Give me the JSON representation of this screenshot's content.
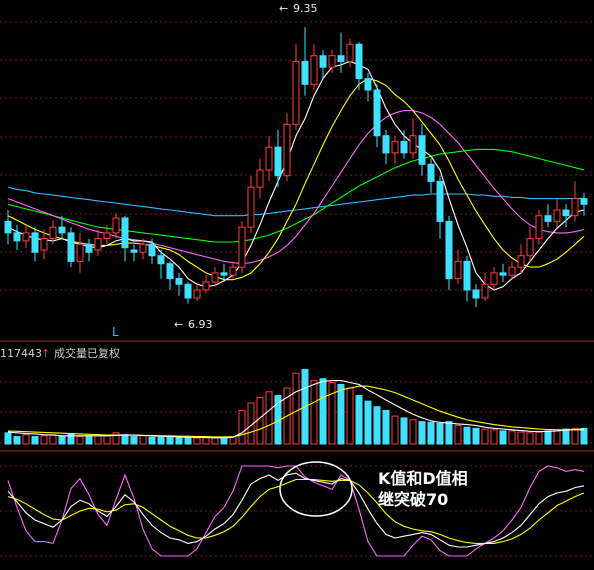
{
  "chart_data": {
    "type": "candlestick",
    "colors": {
      "up": "#ff3b3b",
      "down": "#40e0ff",
      "ma5": "#ffffff",
      "ma10": "#ffff00",
      "ma20": "#ff66ff",
      "ma30": "#00ff00",
      "ma60": "#33bbff",
      "k": "#ffffff",
      "d": "#ffff00",
      "j": "#ff66ff",
      "grid": "#7a1a1a"
    },
    "price": {
      "ylim": [
        6.7,
        9.5
      ],
      "high_label": "9.35",
      "low_label": "6.93",
      "candles": [
        [
          7.65,
          7.55,
          7.75,
          7.45
        ],
        [
          7.55,
          7.48,
          7.62,
          7.4
        ],
        [
          7.48,
          7.55,
          7.62,
          7.42
        ],
        [
          7.55,
          7.38,
          7.6,
          7.3
        ],
        [
          7.4,
          7.5,
          7.58,
          7.32
        ],
        [
          7.5,
          7.6,
          7.66,
          7.45
        ],
        [
          7.6,
          7.55,
          7.7,
          7.5
        ],
        [
          7.55,
          7.3,
          7.6,
          7.25
        ],
        [
          7.3,
          7.45,
          7.55,
          7.2
        ],
        [
          7.45,
          7.38,
          7.5,
          7.3
        ],
        [
          7.4,
          7.5,
          7.58,
          7.35
        ],
        [
          7.5,
          7.55,
          7.62,
          7.45
        ],
        [
          7.55,
          7.68,
          7.72,
          7.5
        ],
        [
          7.68,
          7.42,
          7.7,
          7.3
        ],
        [
          7.4,
          7.38,
          7.45,
          7.3
        ],
        [
          7.38,
          7.45,
          7.5,
          7.32
        ],
        [
          7.45,
          7.35,
          7.5,
          7.28
        ],
        [
          7.35,
          7.28,
          7.4,
          7.15
        ],
        [
          7.28,
          7.15,
          7.3,
          7.05
        ],
        [
          7.15,
          7.1,
          7.2,
          7.0
        ],
        [
          7.1,
          6.98,
          7.12,
          6.93
        ],
        [
          6.98,
          7.05,
          7.1,
          6.95
        ],
        [
          7.05,
          7.12,
          7.18,
          7.02
        ],
        [
          7.12,
          7.2,
          7.25,
          7.08
        ],
        [
          7.2,
          7.18,
          7.28,
          7.12
        ],
        [
          7.18,
          7.25,
          7.3,
          7.15
        ],
        [
          7.25,
          7.6,
          7.65,
          7.2
        ],
        [
          7.6,
          7.95,
          8.05,
          7.55
        ],
        [
          7.95,
          8.1,
          8.2,
          7.85
        ],
        [
          8.1,
          8.3,
          8.4,
          8.0
        ],
        [
          8.3,
          8.05,
          8.45,
          7.95
        ],
        [
          8.05,
          8.5,
          8.6,
          8.0
        ],
        [
          8.5,
          9.05,
          9.2,
          8.45
        ],
        [
          9.05,
          8.85,
          9.35,
          8.75
        ],
        [
          8.85,
          9.1,
          9.2,
          8.8
        ],
        [
          9.1,
          9.0,
          9.15,
          8.9
        ],
        [
          9.0,
          9.1,
          9.15,
          8.95
        ],
        [
          9.1,
          9.05,
          9.3,
          8.95
        ],
        [
          9.05,
          9.2,
          9.25,
          9.0
        ],
        [
          9.2,
          8.9,
          9.22,
          8.8
        ],
        [
          8.9,
          8.8,
          8.95,
          8.7
        ],
        [
          8.8,
          8.4,
          8.85,
          8.3
        ],
        [
          8.4,
          8.25,
          8.45,
          8.15
        ],
        [
          8.25,
          8.35,
          8.4,
          8.15
        ],
        [
          8.35,
          8.25,
          8.45,
          8.2
        ],
        [
          8.25,
          8.4,
          8.55,
          8.2
        ],
        [
          8.4,
          8.15,
          8.5,
          8.05
        ],
        [
          8.15,
          8.0,
          8.2,
          7.9
        ],
        [
          8.0,
          7.65,
          8.05,
          7.5
        ],
        [
          7.65,
          7.15,
          7.7,
          7.05
        ],
        [
          7.15,
          7.3,
          7.4,
          7.1
        ],
        [
          7.3,
          7.05,
          7.35,
          6.95
        ],
        [
          7.05,
          6.98,
          7.1,
          6.9
        ],
        [
          6.98,
          7.1,
          7.2,
          6.95
        ],
        [
          7.1,
          7.2,
          7.25,
          7.05
        ],
        [
          7.2,
          7.18,
          7.28,
          7.12
        ],
        [
          7.18,
          7.25,
          7.3,
          7.15
        ],
        [
          7.25,
          7.35,
          7.45,
          7.2
        ],
        [
          7.35,
          7.5,
          7.6,
          7.3
        ],
        [
          7.5,
          7.7,
          7.75,
          7.45
        ],
        [
          7.7,
          7.65,
          7.8,
          7.6
        ],
        [
          7.65,
          7.75,
          7.85,
          7.6
        ],
        [
          7.75,
          7.7,
          7.8,
          7.6
        ],
        [
          7.7,
          7.85,
          8.0,
          7.65
        ],
        [
          7.85,
          7.8,
          7.9,
          7.7
        ]
      ],
      "ma5": [
        7.6,
        7.56,
        7.53,
        7.5,
        7.49,
        7.48,
        7.5,
        7.47,
        7.45,
        7.43,
        7.42,
        7.44,
        7.48,
        7.5,
        7.48,
        7.48,
        7.47,
        7.38,
        7.32,
        7.25,
        7.15,
        7.1,
        7.08,
        7.09,
        7.13,
        7.18,
        7.29,
        7.44,
        7.62,
        7.82,
        8.0,
        8.18,
        8.4,
        8.55,
        8.75,
        8.9,
        9.0,
        9.02,
        9.05,
        9.02,
        8.98,
        8.82,
        8.64,
        8.5,
        8.4,
        8.33,
        8.28,
        8.22,
        8.1,
        7.85,
        7.62,
        7.42,
        7.2,
        7.1,
        7.05,
        7.08,
        7.15,
        7.2,
        7.3,
        7.4,
        7.5,
        7.59,
        7.66,
        7.73,
        7.75
      ],
      "ma10": [
        7.7,
        7.66,
        7.62,
        7.58,
        7.55,
        7.52,
        7.5,
        7.48,
        7.46,
        7.45,
        7.44,
        7.44,
        7.45,
        7.46,
        7.46,
        7.45,
        7.44,
        7.42,
        7.4,
        7.36,
        7.3,
        7.25,
        7.2,
        7.17,
        7.14,
        7.14,
        7.16,
        7.2,
        7.28,
        7.38,
        7.5,
        7.65,
        7.8,
        7.98,
        8.15,
        8.32,
        8.48,
        8.62,
        8.75,
        8.85,
        8.9,
        8.88,
        8.84,
        8.76,
        8.7,
        8.62,
        8.52,
        8.42,
        8.32,
        8.18,
        8.02,
        7.88,
        7.74,
        7.62,
        7.5,
        7.4,
        7.33,
        7.28,
        7.25,
        7.25,
        7.28,
        7.32,
        7.38,
        7.45,
        7.52
      ],
      "ma20": [
        7.85,
        7.82,
        7.79,
        7.76,
        7.73,
        7.7,
        7.67,
        7.64,
        7.61,
        7.58,
        7.56,
        7.54,
        7.52,
        7.5,
        7.49,
        7.48,
        7.46,
        7.44,
        7.42,
        7.4,
        7.38,
        7.36,
        7.34,
        7.32,
        7.3,
        7.29,
        7.28,
        7.29,
        7.31,
        7.34,
        7.38,
        7.44,
        7.52,
        7.62,
        7.72,
        7.84,
        7.96,
        8.08,
        8.2,
        8.32,
        8.42,
        8.5,
        8.56,
        8.6,
        8.62,
        8.62,
        8.6,
        8.56,
        8.5,
        8.42,
        8.34,
        8.24,
        8.14,
        8.04,
        7.94,
        7.85,
        7.76,
        7.68,
        7.62,
        7.58,
        7.56,
        7.55,
        7.55,
        7.56,
        7.58
      ],
      "ma30": [
        7.8,
        7.78,
        7.76,
        7.74,
        7.72,
        7.7,
        7.68,
        7.66,
        7.64,
        7.62,
        7.6,
        7.59,
        7.58,
        7.57,
        7.56,
        7.55,
        7.54,
        7.53,
        7.52,
        7.51,
        7.5,
        7.49,
        7.48,
        7.47,
        7.47,
        7.47,
        7.48,
        7.49,
        7.51,
        7.53,
        7.56,
        7.59,
        7.63,
        7.67,
        7.71,
        7.76,
        7.81,
        7.86,
        7.91,
        7.96,
        8.0,
        8.04,
        8.08,
        8.12,
        8.15,
        8.18,
        8.2,
        8.22,
        8.24,
        8.25,
        8.26,
        8.27,
        8.28,
        8.28,
        8.28,
        8.27,
        8.26,
        8.24,
        8.22,
        8.2,
        8.18,
        8.16,
        8.14,
        8.12,
        8.1
      ],
      "ma60": [
        7.95,
        7.93,
        7.92,
        7.9,
        7.89,
        7.88,
        7.87,
        7.86,
        7.85,
        7.84,
        7.83,
        7.82,
        7.81,
        7.8,
        7.79,
        7.78,
        7.77,
        7.76,
        7.75,
        7.74,
        7.73,
        7.72,
        7.71,
        7.7,
        7.7,
        7.7,
        7.7,
        7.71,
        7.71,
        7.72,
        7.73,
        7.74,
        7.75,
        7.76,
        7.77,
        7.78,
        7.79,
        7.8,
        7.81,
        7.82,
        7.83,
        7.84,
        7.85,
        7.86,
        7.87,
        7.88,
        7.88,
        7.89,
        7.89,
        7.89,
        7.89,
        7.89,
        7.88,
        7.88,
        7.87,
        7.87,
        7.86,
        7.86,
        7.85,
        7.85,
        7.85,
        7.85,
        7.85,
        7.85,
        7.85
      ]
    },
    "volume": {
      "label_value": "117443",
      "label_text": "成交量已复权",
      "ylim": [
        0,
        220000
      ],
      "bars": [
        30000,
        20000,
        25000,
        20000,
        22000,
        25000,
        20000,
        28000,
        20000,
        22000,
        25000,
        22000,
        30000,
        25000,
        20000,
        22000,
        18000,
        18000,
        20000,
        18000,
        18000,
        16000,
        18000,
        16000,
        18000,
        20000,
        90000,
        110000,
        125000,
        140000,
        130000,
        150000,
        190000,
        200000,
        170000,
        175000,
        165000,
        160000,
        150000,
        130000,
        115000,
        100000,
        90000,
        75000,
        70000,
        65000,
        60000,
        58000,
        55000,
        60000,
        50000,
        45000,
        42000,
        40000,
        38000,
        35000,
        35000,
        32000,
        30000,
        32000,
        35000,
        38000,
        40000,
        42000,
        42000
      ],
      "ma5": [
        32000,
        30000,
        28000,
        27000,
        25000,
        24000,
        22000,
        22000,
        22000,
        22000,
        22000,
        22000,
        23000,
        24000,
        24000,
        23000,
        22000,
        21000,
        20000,
        19000,
        18000,
        18000,
        17000,
        17000,
        17000,
        18000,
        30000,
        50000,
        70000,
        90000,
        110000,
        125000,
        140000,
        150000,
        160000,
        168000,
        170000,
        170000,
        165000,
        160000,
        145000,
        132000,
        118000,
        105000,
        92000,
        80000,
        70000,
        62000,
        58000,
        56000,
        54000,
        52000,
        50000,
        45000,
        42000,
        40000,
        38000,
        36000,
        34000,
        33000,
        34000,
        35000,
        37000,
        39000,
        40000
      ],
      "ma10": [
        35000,
        34000,
        33000,
        32000,
        31000,
        30000,
        29000,
        28000,
        27000,
        26000,
        25000,
        24000,
        24000,
        24000,
        24000,
        23000,
        23000,
        22000,
        22000,
        21000,
        21000,
        20000,
        20000,
        19000,
        19000,
        19000,
        25000,
        32000,
        40000,
        50000,
        62000,
        75000,
        88000,
        100000,
        112000,
        125000,
        135000,
        145000,
        150000,
        155000,
        155000,
        150000,
        145000,
        138000,
        128000,
        118000,
        108000,
        98000,
        88000,
        80000,
        72000,
        65000,
        60000,
        56000,
        52000,
        49000,
        46000,
        44000,
        42000,
        40000,
        39000,
        38000,
        38000,
        38000,
        38000
      ]
    },
    "kdj": {
      "ylim": [
        0,
        100
      ],
      "annotation_line1": "K值和D值相",
      "annotation_line2": "继突破70",
      "low_marker": "L",
      "k": [
        72,
        60,
        48,
        40,
        36,
        32,
        40,
        55,
        62,
        58,
        50,
        44,
        55,
        68,
        60,
        46,
        34,
        26,
        20,
        18,
        14,
        16,
        22,
        30,
        36,
        46,
        62,
        80,
        86,
        90,
        84,
        90,
        92,
        86,
        84,
        82,
        80,
        86,
        84,
        70,
        52,
        36,
        24,
        20,
        22,
        24,
        26,
        24,
        18,
        12,
        10,
        10,
        12,
        14,
        16,
        20,
        26,
        34,
        46,
        58,
        66,
        70,
        72,
        76,
        78
      ],
      "d": [
        66,
        63,
        58,
        52,
        46,
        41,
        40,
        45,
        50,
        53,
        52,
        49,
        51,
        57,
        58,
        54,
        47,
        40,
        33,
        28,
        23,
        20,
        20,
        23,
        27,
        33,
        43,
        55,
        66,
        74,
        77,
        81,
        85,
        85,
        85,
        84,
        83,
        84,
        84,
        79,
        70,
        59,
        47,
        38,
        33,
        30,
        28,
        27,
        24,
        20,
        17,
        15,
        14,
        14,
        14,
        16,
        19,
        24,
        31,
        40,
        48,
        56,
        61,
        66,
        70
      ],
      "j": [
        84,
        54,
        28,
        16,
        16,
        14,
        40,
        75,
        86,
        68,
        46,
        34,
        63,
        90,
        64,
        30,
        8,
        0,
        0,
        0,
        0,
        8,
        26,
        44,
        54,
        72,
        100,
        100,
        100,
        100,
        98,
        100,
        100,
        88,
        82,
        78,
        74,
        90,
        84,
        52,
        16,
        0,
        0,
        0,
        0,
        12,
        22,
        18,
        6,
        0,
        0,
        0,
        8,
        14,
        20,
        28,
        40,
        54,
        76,
        94,
        100,
        98,
        94,
        96,
        94
      ]
    }
  }
}
